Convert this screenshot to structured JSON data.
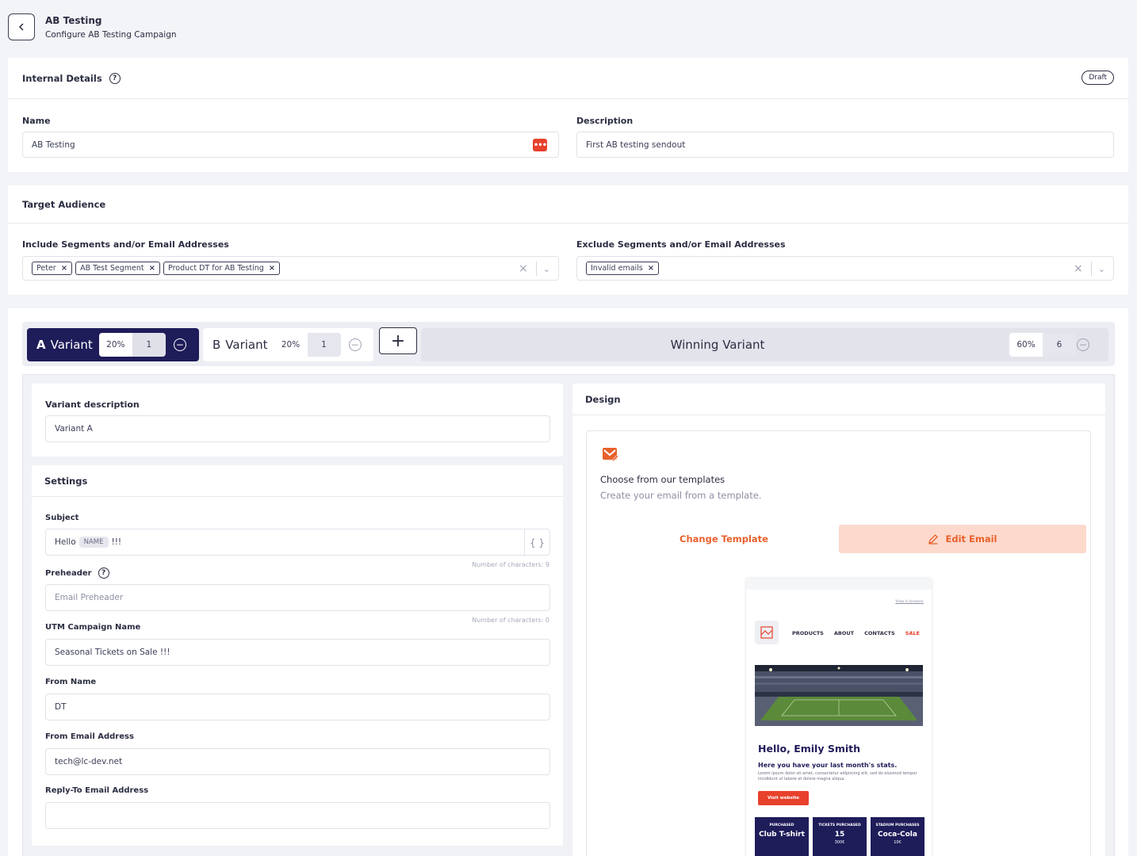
{
  "header": {
    "title": "AB Testing",
    "subtitle": "Configure AB Testing Campaign"
  },
  "internal": {
    "title": "Internal Details",
    "status": "Draft",
    "name_label": "Name",
    "name_value": "AB Testing",
    "description_label": "Description",
    "description_value": "First AB testing sendout"
  },
  "audience": {
    "title": "Target Audience",
    "include_label": "Include Segments and/or Email Addresses",
    "include_chips": [
      "Peter",
      "AB Test Segment",
      "Product DT for AB Testing"
    ],
    "exclude_label": "Exclude Segments and/or Email Addresses",
    "exclude_chips": [
      "Invalid emails"
    ]
  },
  "variants": {
    "a": {
      "letter": "A",
      "name": "Variant",
      "percent": "20%",
      "count": "1"
    },
    "b": {
      "letter": "B",
      "name": "Variant",
      "percent": "20%",
      "count": "1"
    },
    "add_symbol": "+",
    "winner": {
      "label": "Winning Variant",
      "percent": "60%",
      "count": "6"
    }
  },
  "variant_form": {
    "description_label": "Variant description",
    "description_value": "Variant A",
    "settings_title": "Settings",
    "subject_label": "Subject",
    "subject_prefix": "Hello",
    "subject_tag": "NAME",
    "subject_suffix": "!!!",
    "subject_char_count": "Number of characters: 9",
    "preheader_label": "Preheader",
    "preheader_placeholder": "Email Preheader",
    "preheader_char_count": "Number of characters: 0",
    "utm_label": "UTM Campaign Name",
    "utm_value": "Seasonal Tickets on Sale !!!",
    "from_name_label": "From Name",
    "from_name_value": "DT",
    "from_email_label": "From Email Address",
    "from_email_value": "tech@lc-dev.net",
    "reply_to_label": "Reply-To Email Address",
    "reply_to_value": ""
  },
  "design": {
    "title": "Design",
    "template_title": "Choose from our templates",
    "template_subtitle": "Create your email from a template.",
    "change_template": "Change Template",
    "edit_email": "Edit Email",
    "preview": {
      "view_in_browser": "View in browser",
      "nav": [
        "PRODUCTS",
        "ABOUT",
        "CONTACTS",
        "SALE"
      ],
      "greeting": "Hello, Emily Smith",
      "stats_heading": "Here you have your last month's stats.",
      "lorem": "Lorem ipsum dolor sit amet, consectetur adipiscing elit, sed do eiusmod tempor incididunt ut labore et dolore magna aliqua.",
      "visit_button": "Visit website",
      "stats": [
        {
          "label": "PURCHASED",
          "value": "Club T-shirt",
          "price": ""
        },
        {
          "label": "TICKETS PURCHASED",
          "value": "15",
          "price": "300€"
        },
        {
          "label": "STADIUM PURCHASES",
          "value": "Coca-Cola",
          "price": "10€"
        }
      ]
    }
  },
  "colors": {
    "accent": "#e8612c",
    "navy": "#1f1c5a",
    "background": "#f3f4f8"
  }
}
